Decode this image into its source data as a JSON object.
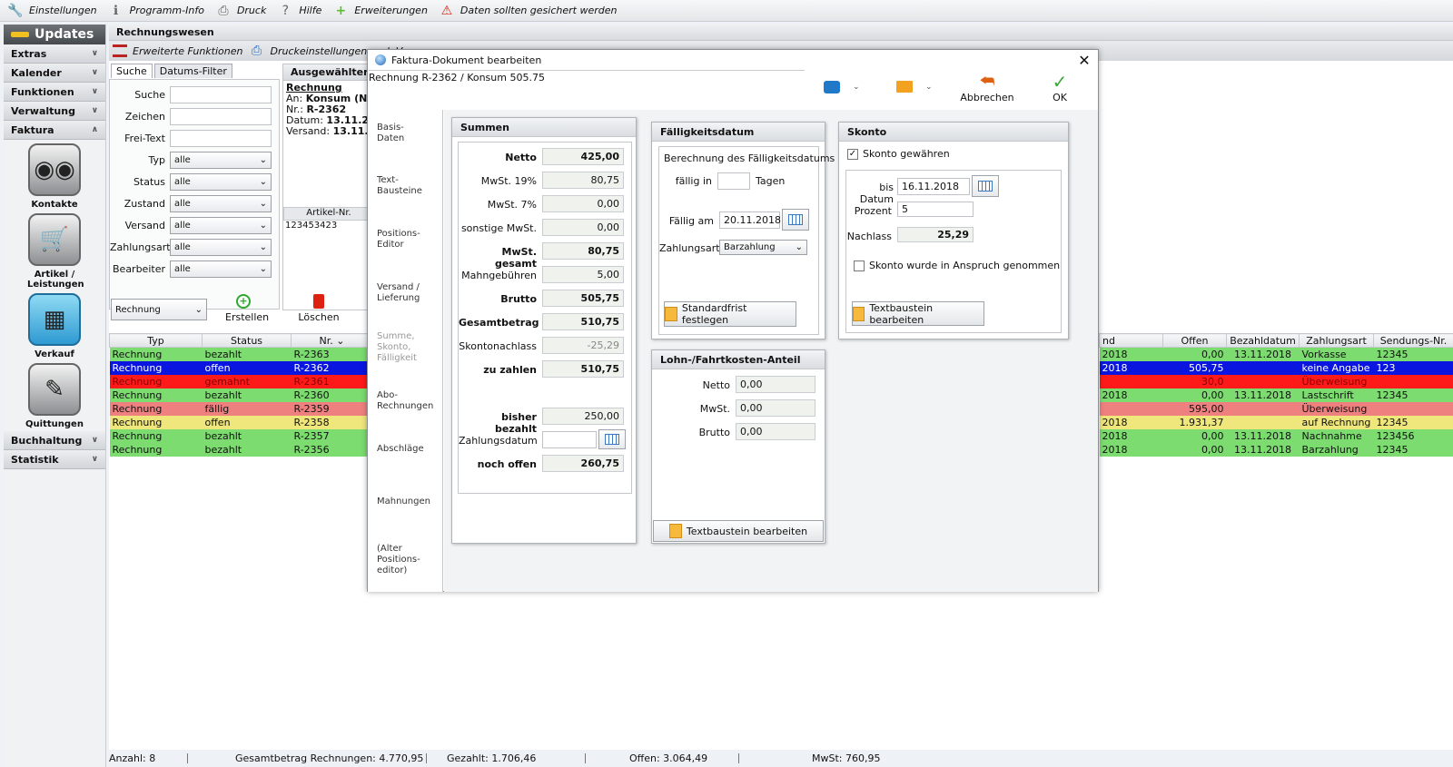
{
  "toolbar": {
    "items": [
      {
        "label": "Einstellungen",
        "icon": "wrench-icon"
      },
      {
        "label": "Programm-Info",
        "icon": "info-icon"
      },
      {
        "label": "Druck",
        "icon": "printer-icon"
      },
      {
        "label": "Hilfe",
        "icon": "help-icon"
      },
      {
        "label": "Erweiterungen",
        "icon": "plus-icon"
      },
      {
        "label": "Daten sollten gesichert werden",
        "icon": "warning-icon"
      }
    ]
  },
  "sidebar": {
    "updates": "Updates",
    "sections": [
      "Extras",
      "Kalender",
      "Funktionen",
      "Verwaltung",
      "Faktura"
    ],
    "faktura_buttons": [
      "Kontakte",
      "Artikel / Leistungen",
      "Verkauf",
      "Quittungen"
    ],
    "bottom_sections": [
      "Buchhaltung",
      "Statistik"
    ]
  },
  "module": {
    "title": "Rechnungswesen",
    "toolbar_items": [
      "Erweiterte Funktionen",
      "Druckeinstellungen und -V"
    ],
    "tabs": [
      "Suche",
      "Datums-Filter"
    ]
  },
  "search": {
    "labels": [
      "Suche",
      "Zeichen",
      "Frei-Text",
      "Typ",
      "Status",
      "Zustand",
      "Versand",
      "Zahlungsart",
      "Bearbeiter"
    ],
    "select_value": "alle"
  },
  "selected": {
    "header": "Ausgewählter Da",
    "type": "Rechnung",
    "an_label": "An:",
    "an": "Konsum (Nr. 1",
    "nr_label": "Nr.:",
    "nr": "R-2362",
    "datum_label": "Datum:",
    "datum": "13.11.2018",
    "versand_label": "Versand:",
    "versand": "13.11.20",
    "art_hdr": "Artikel-Nr.",
    "art_val": "123453423"
  },
  "list": {
    "doc_type": "Rechnung",
    "create": "Erstellen",
    "delete": "Löschen",
    "left_headers": [
      "Typ",
      "Status",
      "Nr."
    ],
    "right_headers": [
      "nd",
      "Offen",
      "Bezahldatum",
      "Zahlungsart",
      "Sendungs-Nr."
    ],
    "rows": [
      {
        "typ": "Rechnung",
        "status": "bezahlt",
        "nr": "R-2363",
        "nd": "2018",
        "offen": "0,00",
        "bez": "13.11.2018",
        "art": "Vorkasse",
        "snr": "12345",
        "cls": "r-g"
      },
      {
        "typ": "Rechnung",
        "status": "offen",
        "nr": "R-2362",
        "nd": "2018",
        "offen": "505,75",
        "bez": "",
        "art": "keine Angabe",
        "snr": "123",
        "cls": "r-b"
      },
      {
        "typ": "Rechnung",
        "status": "gemahnt",
        "nr": "R-2361",
        "nd": "",
        "offen": "30,0",
        "bez": "",
        "art": "Überweisung",
        "snr": "",
        "cls": "r-r"
      },
      {
        "typ": "Rechnung",
        "status": "bezahlt",
        "nr": "R-2360",
        "nd": "2018",
        "offen": "0,00",
        "bez": "13.11.2018",
        "art": "Lastschrift",
        "snr": "12345",
        "cls": "r-g"
      },
      {
        "typ": "Rechnung",
        "status": "fällig",
        "nr": "R-2359",
        "nd": "",
        "offen": "595,00",
        "bez": "",
        "art": "Überweisung",
        "snr": "",
        "cls": "r-rl"
      },
      {
        "typ": "Rechnung",
        "status": "offen",
        "nr": "R-2358",
        "nd": "2018",
        "offen": "1.931,37",
        "bez": "",
        "art": "auf Rechnung",
        "snr": "12345",
        "cls": "r-y"
      },
      {
        "typ": "Rechnung",
        "status": "bezahlt",
        "nr": "R-2357",
        "nd": "2018",
        "offen": "0,00",
        "bez": "13.11.2018",
        "art": "Nachnahme",
        "snr": "123456",
        "cls": "r-g"
      },
      {
        "typ": "Rechnung",
        "status": "bezahlt",
        "nr": "R-2356",
        "nd": "2018",
        "offen": "0,00",
        "bez": "13.11.2018",
        "art": "Barzahlung",
        "snr": "12345",
        "cls": "r-g"
      }
    ]
  },
  "status": {
    "anzahl": "Anzahl: 8",
    "gesamt": "Gesamtbetrag Rechnungen: 4.770,95",
    "gezahlt": "Gezahlt: 1.706,46",
    "offen": "Offen: 3.064,49",
    "mwst": "MwSt: 760,95"
  },
  "dialog": {
    "title": "Faktura-Dokument bearbeiten",
    "subtitle": "Rechnung R-2362 / Konsum 505.75",
    "abbrechen": "Abbrechen",
    "ok": "OK",
    "nav": [
      "Basis-\nDaten",
      "Text-\nBausteine",
      "Positions-\nEditor",
      "Versand /\nLieferung",
      "Summe,\nSkonto,\nFälligkeit",
      "Abo-\nRechnungen",
      "Abschläge",
      "Mahnungen",
      "(Alter\nPositions-\neditor)"
    ],
    "summen": {
      "header": "Summen",
      "rows": [
        {
          "label": "Netto",
          "value": "425,00",
          "bold": true
        },
        {
          "label": "MwSt. 19%",
          "value": "80,75",
          "bold": false
        },
        {
          "label": "MwSt. 7%",
          "value": "0,00",
          "bold": false
        },
        {
          "label": "sonstige MwSt.",
          "value": "0,00",
          "bold": false
        },
        {
          "label": "MwSt. gesamt",
          "value": "80,75",
          "bold": true
        },
        {
          "label": "Mahngebühren",
          "value": "5,00",
          "bold": false
        },
        {
          "label": "Brutto",
          "value": "505,75",
          "bold": true
        },
        {
          "label": "Gesamtbetrag",
          "value": "510,75",
          "bold": true
        },
        {
          "label": "Skontonachlass",
          "value": "-25,29",
          "bold": false
        },
        {
          "label": "zu zahlen",
          "value": "510,75",
          "bold": true
        }
      ],
      "bisher_label": "bisher bezahlt",
      "bisher": "250,00",
      "zdatum_label": "Zahlungsdatum",
      "zdatum": "",
      "offen_label": "noch offen",
      "offen": "260,75"
    },
    "faellig": {
      "header": "Fälligkeitsdatum",
      "calc": "Berechnung des Fälligkeitsdatums",
      "in_label": "fällig in",
      "in_value": "",
      "tage": "Tagen",
      "am_label": "Fällig am",
      "am_value": "20.11.2018",
      "za_label": "Zahlungsart",
      "za_value": "Barzahlung",
      "button": "Standardfrist festlegen"
    },
    "lohn": {
      "header": "Lohn-/Fahrtkosten-Anteil",
      "netto_label": "Netto",
      "netto": "0,00",
      "mwst_label": "MwSt.",
      "mwst": "0,00",
      "brutto_label": "Brutto",
      "brutto": "0,00",
      "button": "Textbaustein bearbeiten"
    },
    "skonto": {
      "header": "Skonto",
      "gewaehren": "Skonto gewähren",
      "bis_label": "bis Datum",
      "bis": "16.11.2018",
      "prozent_label": "Prozent",
      "prozent": "5",
      "nachlass_label": "Nachlass",
      "nachlass": "25,29",
      "genommen": "Skonto wurde in Anspruch genommen",
      "button": "Textbaustein bearbeiten"
    }
  }
}
